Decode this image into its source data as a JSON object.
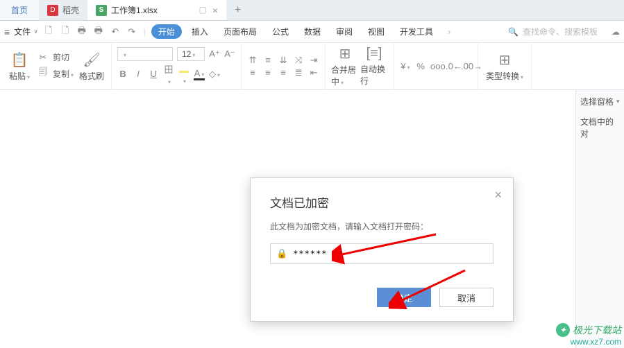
{
  "tabs": {
    "home": "首页",
    "docer": "稻壳",
    "active_file": "工作簿1.xlsx"
  },
  "file_menu": "文件",
  "ribbon_tabs": {
    "start": "开始",
    "insert": "插入",
    "layout": "页面布局",
    "formula": "公式",
    "data": "数据",
    "review": "审阅",
    "view": "视图",
    "dev": "开发工具"
  },
  "search_placeholder": "查找命令、搜索模板",
  "ribbon": {
    "paste": "粘贴",
    "cut": "剪切",
    "copy": "复制",
    "format_painter": "格式刷",
    "font_size": "12",
    "merge_center": "合并居中",
    "auto_wrap": "自动换行",
    "type_convert": "类型转换"
  },
  "side": {
    "select_pane": "选择窗格",
    "doc_objects": "文档中的对"
  },
  "dialog": {
    "title": "文档已加密",
    "message": "此文档为加密文档，请输入文档打开密码：",
    "password_value": "******",
    "ok": "确定",
    "cancel": "取消"
  },
  "watermark": {
    "name": "极光下载站",
    "url": "www.xz7.com"
  }
}
